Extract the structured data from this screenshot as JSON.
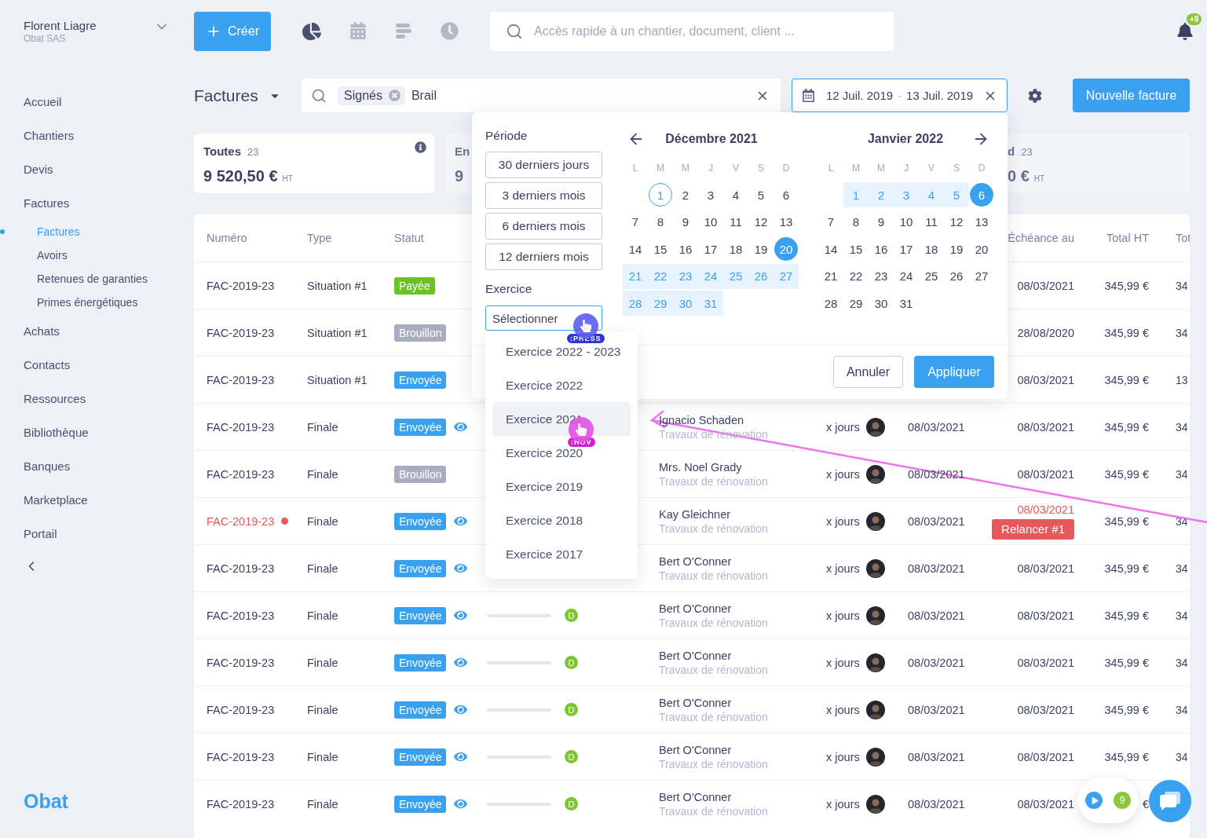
{
  "user": {
    "name": "Florent Liagre",
    "company": "Obat SAS"
  },
  "create_button": "Créer",
  "tools": [
    {
      "kind": "pie",
      "selected": true
    },
    {
      "kind": "calendar",
      "selected": false
    },
    {
      "kind": "bars",
      "selected": false
    },
    {
      "kind": "clock",
      "selected": false
    }
  ],
  "quick_search": {
    "placeholder": "Accès rapide à un chantier, document, client ..."
  },
  "notifications": {
    "badge": "+9"
  },
  "sidebar": {
    "items": [
      {
        "label": "Accueil",
        "selected": false
      },
      {
        "label": "Chantiers",
        "selected": false
      },
      {
        "label": "Devis",
        "selected": false
      },
      {
        "label": "Factures",
        "selected": false,
        "children": [
          {
            "label": "Factures",
            "selected": true
          },
          {
            "label": "Avoirs",
            "selected": false
          },
          {
            "label": "Retenues de garanties",
            "selected": false
          },
          {
            "label": "Primes énergétiques",
            "selected": false
          }
        ]
      },
      {
        "label": "Achats",
        "selected": false
      },
      {
        "label": "Contacts",
        "selected": false
      },
      {
        "label": "Ressources",
        "selected": false
      },
      {
        "label": "Bibliothèque",
        "selected": false
      },
      {
        "label": "Banques",
        "selected": false
      },
      {
        "label": "Marketplace",
        "selected": false
      },
      {
        "label": "Portail",
        "selected": false
      }
    ],
    "logo": "Obat"
  },
  "toolbar": {
    "title": "Factures",
    "filter_chip": "Signés",
    "filter_text": "Brail",
    "date_range": {
      "start": "12 Juil. 2019",
      "separator": "-",
      "end": "13 Juil. 2019"
    },
    "new_button": "Nouvelle facture"
  },
  "cards": [
    {
      "title": "Toutes",
      "count": "23",
      "amount": "9 520,50 €",
      "unit": "HT",
      "selected": true
    },
    {
      "title": "En",
      "amount": "9",
      "selected": false
    },
    {
      "title": "d",
      "count": "23",
      "amount": "0 €",
      "unit": "HT",
      "selected": false
    }
  ],
  "table": {
    "columns": [
      "Numéro",
      "Type",
      "Statut",
      "Échéance au",
      "Total HT",
      "Tot"
    ],
    "rows": [
      {
        "number": "FAC-2019-23",
        "overdue": false,
        "type": "Situation #1",
        "status": {
          "label": "Payée",
          "kind": "paid"
        },
        "eye": false,
        "due": "08/03/2021",
        "total": "345,99 €",
        "last": "34"
      },
      {
        "number": "FAC-2019-23",
        "overdue": false,
        "type": "Situation #1",
        "status": {
          "label": "Brouillon",
          "kind": "draft"
        },
        "eye": false,
        "due": "28/08/2020",
        "total": "345,99 €",
        "last": "34"
      },
      {
        "number": "FAC-2019-23",
        "overdue": false,
        "type": "Situation #1",
        "status": {
          "label": "Envoyée",
          "kind": "sent"
        },
        "eye": false,
        "due": "08/03/2021",
        "total": "345,99 €",
        "last": "13"
      },
      {
        "number": "FAC-2019-23",
        "overdue": false,
        "type": "Finale",
        "status": {
          "label": "Envoyée",
          "kind": "sent"
        },
        "eye": true,
        "client": "Ignacio Schaden",
        "project": "Travaux de rénovation",
        "delay": "x jours",
        "date": "08/03/2021",
        "due": "08/03/2021",
        "total": "345,99 €",
        "last": "34"
      },
      {
        "number": "FAC-2019-23",
        "overdue": false,
        "type": "Finale",
        "status": {
          "label": "Brouillon",
          "kind": "draft"
        },
        "eye": false,
        "client": "Mrs. Noel Grady",
        "project": "Travaux de rénovation",
        "delay": "x jours",
        "date": "08/03/2021",
        "due": "08/03/2021",
        "total": "345,99 €",
        "last": "34"
      },
      {
        "number": "FAC-2019-23",
        "overdue": true,
        "type": "Finale",
        "status": {
          "label": "Envoyée",
          "kind": "sent"
        },
        "eye": true,
        "client": "Kay Gleichner",
        "project": "Travaux de rénovation",
        "delay": "x jours",
        "date": "08/03/2021",
        "due": "08/03/2021",
        "relance": "Relancer #1",
        "total": "345,99 €",
        "last": "34"
      },
      {
        "number": "FAC-2019-23",
        "overdue": false,
        "type": "Finale",
        "status": {
          "label": "Envoyée",
          "kind": "sent"
        },
        "eye": true,
        "client": "Bert O'Conner",
        "project": "Travaux de rénovation",
        "delay": "x jours",
        "date": "08/03/2021",
        "due": "08/03/2021",
        "total": "345,99 €",
        "last": "34"
      },
      {
        "number": "FAC-2019-23",
        "overdue": false,
        "type": "Finale",
        "status": {
          "label": "Envoyée",
          "kind": "sent"
        },
        "eye": true,
        "progress": {
          "badge": "D"
        },
        "client": "Bert O'Conner",
        "project": "Travaux de rénovation",
        "delay": "x jours",
        "date": "08/03/2021",
        "due": "08/03/2021",
        "total": "345,99 €",
        "last": "34"
      },
      {
        "number": "FAC-2019-23",
        "overdue": false,
        "type": "Finale",
        "status": {
          "label": "Envoyée",
          "kind": "sent"
        },
        "eye": true,
        "progress": {
          "badge": "D"
        },
        "client": "Bert O'Conner",
        "project": "Travaux de rénovation",
        "delay": "x jours",
        "date": "08/03/2021",
        "due": "08/03/2021",
        "total": "345,99 €",
        "last": "34"
      },
      {
        "number": "FAC-2019-23",
        "overdue": false,
        "type": "Finale",
        "status": {
          "label": "Envoyée",
          "kind": "sent"
        },
        "eye": true,
        "progress": {
          "badge": "D"
        },
        "client": "Bert O'Conner",
        "project": "Travaux de rénovation",
        "delay": "x jours",
        "date": "08/03/2021",
        "due": "08/03/2021",
        "total": "345,99 €",
        "last": "34"
      },
      {
        "number": "FAC-2019-23",
        "overdue": false,
        "type": "Finale",
        "status": {
          "label": "Envoyée",
          "kind": "sent"
        },
        "eye": true,
        "progress": {
          "badge": "D"
        },
        "client": "Bert O'Conner",
        "project": "Travaux de rénovation",
        "delay": "x jours",
        "date": "08/03/2021",
        "due": "08/03/2021",
        "total": "345,99 €",
        "last": "34"
      },
      {
        "number": "FAC-2019-23",
        "overdue": false,
        "type": "Finale",
        "status": {
          "label": "Envoyée",
          "kind": "sent"
        },
        "eye": true,
        "progress": {
          "badge": "D"
        },
        "client": "Bert O'Conner",
        "project": "Travaux de rénovation",
        "delay": "x jours",
        "date": "08/03/2021",
        "due": "08/03/2021",
        "total": "€"
      }
    ]
  },
  "date_picker": {
    "period_title": "Période",
    "presets": [
      "30 derniers jours",
      "3 derniers mois",
      "6 derniers mois",
      "12 derniers mois"
    ],
    "fiscal_title": "Exercice",
    "fiscal_select": "Sélectionner",
    "months": [
      {
        "title": "Décembre 2021",
        "weekdays": [
          "L",
          "M",
          "M",
          "J",
          "V",
          "S",
          "D"
        ],
        "weeks": [
          {
            "days": [
              {
                "d": "1",
                "outlined": true,
                "in_range": false,
                "selected": false
              },
              {
                "d": "2",
                "outlined": false,
                "in_range": false,
                "selected": false
              },
              {
                "d": "3",
                "outlined": false,
                "in_range": false,
                "selected": false
              },
              {
                "d": "4",
                "outlined": false,
                "in_range": false,
                "selected": false
              },
              {
                "d": "5",
                "outlined": false,
                "in_range": false,
                "selected": false
              },
              {
                "d": "6",
                "outlined": false,
                "in_range": false,
                "selected": false
              }
            ]
          },
          {
            "days": [
              {
                "d": "7",
                "outlined": false,
                "in_range": false,
                "selected": false
              },
              {
                "d": "8",
                "outlined": false,
                "in_range": false,
                "selected": false
              },
              {
                "d": "9",
                "outlined": false,
                "in_range": false,
                "selected": false
              },
              {
                "d": "10",
                "outlined": false,
                "in_range": false,
                "selected": false
              },
              {
                "d": "11",
                "outlined": false,
                "in_range": false,
                "selected": false
              },
              {
                "d": "12",
                "outlined": false,
                "in_range": false,
                "selected": false
              },
              {
                "d": "13",
                "outlined": false,
                "in_range": false,
                "selected": false
              }
            ]
          },
          {
            "days": [
              {
                "d": "14",
                "outlined": false,
                "in_range": false,
                "selected": false
              },
              {
                "d": "15",
                "outlined": false,
                "in_range": false,
                "selected": false
              },
              {
                "d": "16",
                "outlined": false,
                "in_range": false,
                "selected": false
              },
              {
                "d": "17",
                "outlined": false,
                "in_range": false,
                "selected": false
              },
              {
                "d": "18",
                "outlined": false,
                "in_range": false,
                "selected": false
              },
              {
                "d": "19",
                "outlined": false,
                "in_range": false,
                "selected": false
              },
              {
                "d": "20",
                "outlined": false,
                "in_range": false,
                "selected": true
              }
            ]
          },
          {
            "days": [
              {
                "d": "21",
                "outlined": false,
                "in_range": true,
                "selected": false
              },
              {
                "d": "22",
                "outlined": false,
                "in_range": true,
                "selected": false
              },
              {
                "d": "23",
                "outlined": false,
                "in_range": true,
                "selected": false
              },
              {
                "d": "24",
                "outlined": false,
                "in_range": true,
                "selected": false
              },
              {
                "d": "25",
                "outlined": false,
                "in_range": true,
                "selected": false
              },
              {
                "d": "26",
                "outlined": false,
                "in_range": true,
                "selected": false
              },
              {
                "d": "27",
                "outlined": false,
                "in_range": true,
                "selected": false
              }
            ]
          },
          {
            "days": [
              {
                "d": "28",
                "outlined": false,
                "in_range": true,
                "selected": false
              },
              {
                "d": "29",
                "outlined": false,
                "in_range": true,
                "selected": false
              },
              {
                "d": "30",
                "outlined": false,
                "in_range": true,
                "selected": false
              },
              {
                "d": "31",
                "outlined": false,
                "in_range": true,
                "selected": false
              }
            ]
          }
        ]
      },
      {
        "title": "Janvier 2022",
        "weekdays": [
          "L",
          "M",
          "M",
          "J",
          "V",
          "S",
          "D"
        ],
        "weeks": [
          {
            "days": [
              {
                "d": "1",
                "outlined": false,
                "in_range": true,
                "selected": false
              },
              {
                "d": "2",
                "outlined": false,
                "in_range": true,
                "selected": false
              },
              {
                "d": "3",
                "outlined": false,
                "in_range": true,
                "selected": false
              },
              {
                "d": "4",
                "outlined": false,
                "in_range": true,
                "selected": false
              },
              {
                "d": "5",
                "outlined": false,
                "in_range": true,
                "selected": false
              },
              {
                "d": "6",
                "outlined": false,
                "in_range": false,
                "selected": true
              }
            ]
          },
          {
            "days": [
              {
                "d": "7",
                "outlined": false,
                "in_range": false,
                "selected": false
              },
              {
                "d": "8",
                "outlined": false,
                "in_range": false,
                "selected": false
              },
              {
                "d": "9",
                "outlined": false,
                "in_range": false,
                "selected": false
              },
              {
                "d": "10",
                "outlined": false,
                "in_range": false,
                "selected": false
              },
              {
                "d": "11",
                "outlined": false,
                "in_range": false,
                "selected": false
              },
              {
                "d": "12",
                "outlined": false,
                "in_range": false,
                "selected": false
              },
              {
                "d": "13",
                "outlined": false,
                "in_range": false,
                "selected": false
              }
            ]
          },
          {
            "days": [
              {
                "d": "14",
                "outlined": false,
                "in_range": false,
                "selected": false
              },
              {
                "d": "15",
                "outlined": false,
                "in_range": false,
                "selected": false
              },
              {
                "d": "16",
                "outlined": false,
                "in_range": false,
                "selected": false
              },
              {
                "d": "17",
                "outlined": false,
                "in_range": false,
                "selected": false
              },
              {
                "d": "18",
                "outlined": false,
                "in_range": false,
                "selected": false
              },
              {
                "d": "19",
                "outlined": false,
                "in_range": false,
                "selected": false
              },
              {
                "d": "20",
                "outlined": false,
                "in_range": false,
                "selected": false
              }
            ]
          },
          {
            "days": [
              {
                "d": "21",
                "outlined": false,
                "in_range": false,
                "selected": false
              },
              {
                "d": "22",
                "outlined": false,
                "in_range": false,
                "selected": false
              },
              {
                "d": "23",
                "outlined": false,
                "in_range": false,
                "selected": false
              },
              {
                "d": "24",
                "outlined": false,
                "in_range": false,
                "selected": false
              },
              {
                "d": "25",
                "outlined": false,
                "in_range": false,
                "selected": false
              },
              {
                "d": "26",
                "outlined": false,
                "in_range": false,
                "selected": false
              },
              {
                "d": "27",
                "outlined": false,
                "in_range": false,
                "selected": false
              }
            ]
          },
          {
            "days": [
              {
                "d": "28",
                "outlined": false,
                "in_range": false,
                "selected": false
              },
              {
                "d": "29",
                "outlined": false,
                "in_range": false,
                "selected": false
              },
              {
                "d": "30",
                "outlined": false,
                "in_range": false,
                "selected": false
              },
              {
                "d": "31",
                "outlined": false,
                "in_range": false,
                "selected": false
              }
            ]
          }
        ]
      }
    ],
    "cancel": "Annuler",
    "apply": "Appliquer"
  },
  "fiscal_options": [
    {
      "label": "Exercice 2022 - 2023",
      "hovered": false
    },
    {
      "label": "Exercice 2022",
      "hovered": false
    },
    {
      "label": "Exercice 2021",
      "hovered": true
    },
    {
      "label": "Exercice 2020",
      "hovered": false
    },
    {
      "label": "Exercice 2019",
      "hovered": false
    },
    {
      "label": "Exercice 2018",
      "hovered": false
    },
    {
      "label": "Exercice 2017",
      "hovered": false
    }
  ],
  "floating": {
    "badge": "9"
  },
  "annotations": [
    {
      "kind": "press",
      "label": ":PRESS"
    },
    {
      "kind": "hover",
      "label": ":HOV"
    },
    {
      "kind": "arrow"
    }
  ]
}
